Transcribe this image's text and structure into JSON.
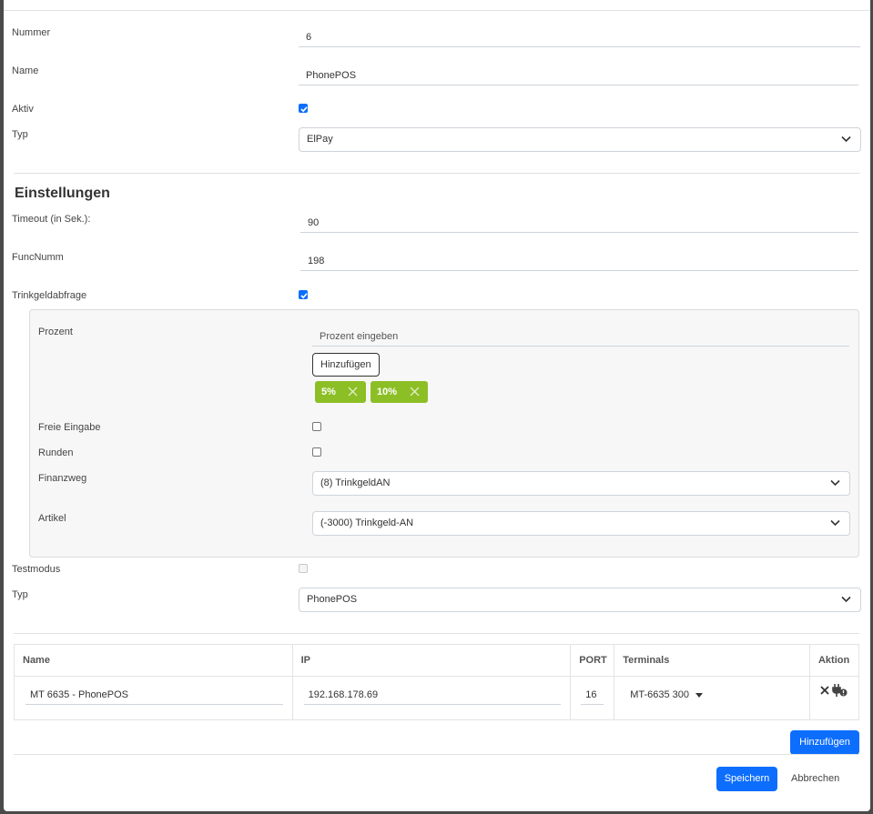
{
  "form": {
    "nummer_label": "Nummer",
    "nummer_value": "6",
    "name_label": "Name",
    "name_value": "PhonePOS",
    "aktiv_label": "Aktiv",
    "aktiv_checked": true,
    "typ_label": "Typ",
    "typ_value": "ElPay"
  },
  "settings": {
    "title": "Einstellungen",
    "timeout_label": "Timeout (in Sek.):",
    "timeout_value": "90",
    "funcnumm_label": "FuncNumm",
    "funcnumm_value": "198",
    "trinkgeld_label": "Trinkgeldabfrage",
    "trinkgeld_checked": true,
    "tip": {
      "prozent_label": "Prozent",
      "prozent_placeholder": "Prozent eingeben",
      "add_button": "Hinzufügen",
      "tags": [
        "5%",
        "10%"
      ],
      "tag_color": "#8cbf26",
      "freie_eingabe_label": "Freie Eingabe",
      "runden_label": "Runden",
      "finanzweg_label": "Finanzweg",
      "finanzweg_value": "(8) TrinkgeldAN",
      "artikel_label": "Artikel",
      "artikel_value": "(-3000) Trinkgeld-AN"
    },
    "testmodus_label": "Testmodus",
    "typ2_label": "Typ",
    "typ2_value": "PhonePOS"
  },
  "terminals_table": {
    "headers": [
      "Name",
      "IP",
      "PORT",
      "Terminals",
      "Aktion"
    ],
    "rows": [
      {
        "name": "MT 6635 - PhonePOS",
        "ip": "192.168.178.69",
        "port": "16",
        "terminal": "MT-6635 300"
      }
    ],
    "add_button": "Hinzufügen"
  },
  "footer": {
    "save_button": "Speichern",
    "cancel_button": "Abbrechen"
  },
  "colors": {
    "primary": "#0d6efd",
    "tag_green": "#8cbf26"
  }
}
